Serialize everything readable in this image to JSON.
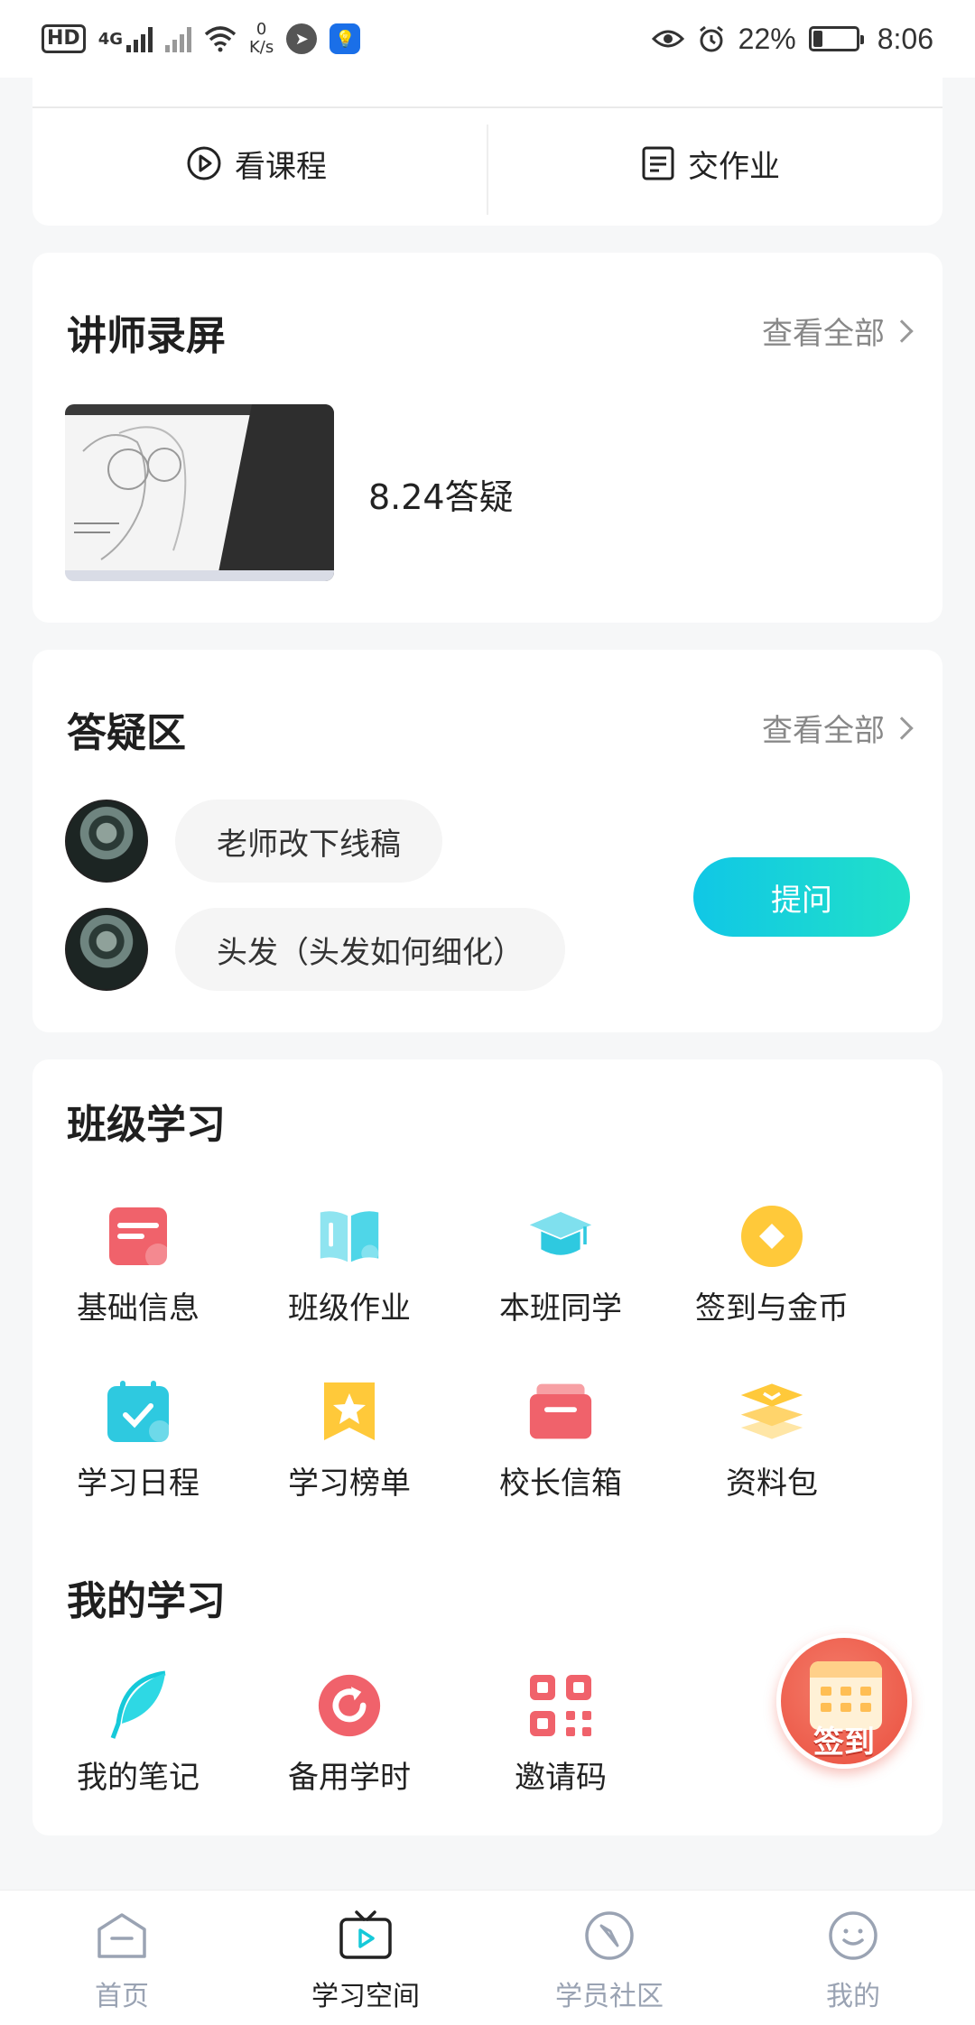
{
  "status_bar": {
    "hd": "HD",
    "net": "4G",
    "speed_value": "0",
    "speed_unit": "K/s",
    "battery_text": "22%",
    "battery_level": 0.22,
    "time": "8:06"
  },
  "quick_actions": {
    "course": "看课程",
    "homework": "交作业"
  },
  "recordings": {
    "title": "讲师录屏",
    "see_all": "查看全部",
    "item_title": "8.24答疑"
  },
  "qa": {
    "title": "答疑区",
    "see_all": "查看全部",
    "items": [
      {
        "text": "老师改下线稿"
      },
      {
        "text": "头发（头发如何细化）"
      }
    ],
    "ask_button": "提问"
  },
  "class_study": {
    "title": "班级学习",
    "items": [
      {
        "label": "基础信息",
        "icon": "info-card-icon"
      },
      {
        "label": "班级作业",
        "icon": "book-icon"
      },
      {
        "label": "本班同学",
        "icon": "graduation-cap-icon"
      },
      {
        "label": "签到与金币",
        "icon": "coin-icon"
      },
      {
        "label": "学习日程",
        "icon": "calendar-check-icon"
      },
      {
        "label": "学习榜单",
        "icon": "star-bookmark-icon"
      },
      {
        "label": "校长信箱",
        "icon": "mailbox-icon"
      },
      {
        "label": "资料包",
        "icon": "layers-icon"
      }
    ]
  },
  "my_study": {
    "title": "我的学习",
    "items": [
      {
        "label": "我的笔记",
        "icon": "feather-icon"
      },
      {
        "label": "备用学时",
        "icon": "refresh-icon"
      },
      {
        "label": "邀请码",
        "icon": "qr-code-icon"
      }
    ]
  },
  "checkin_button": "签到",
  "tabbar": {
    "items": [
      {
        "label": "首页",
        "icon": "home-icon"
      },
      {
        "label": "学习空间",
        "icon": "tv-play-icon"
      },
      {
        "label": "学员社区",
        "icon": "compass-icon"
      },
      {
        "label": "我的",
        "icon": "smile-icon"
      }
    ],
    "active": "学习空间"
  },
  "colors": {
    "accent_gradient_start": "#10c7e6",
    "accent_gradient_end": "#21e0c8",
    "red": "#f0626b",
    "teal": "#4fd6e8",
    "yellow": "#ffc93a",
    "tab_inactive": "#9aa3b3"
  }
}
